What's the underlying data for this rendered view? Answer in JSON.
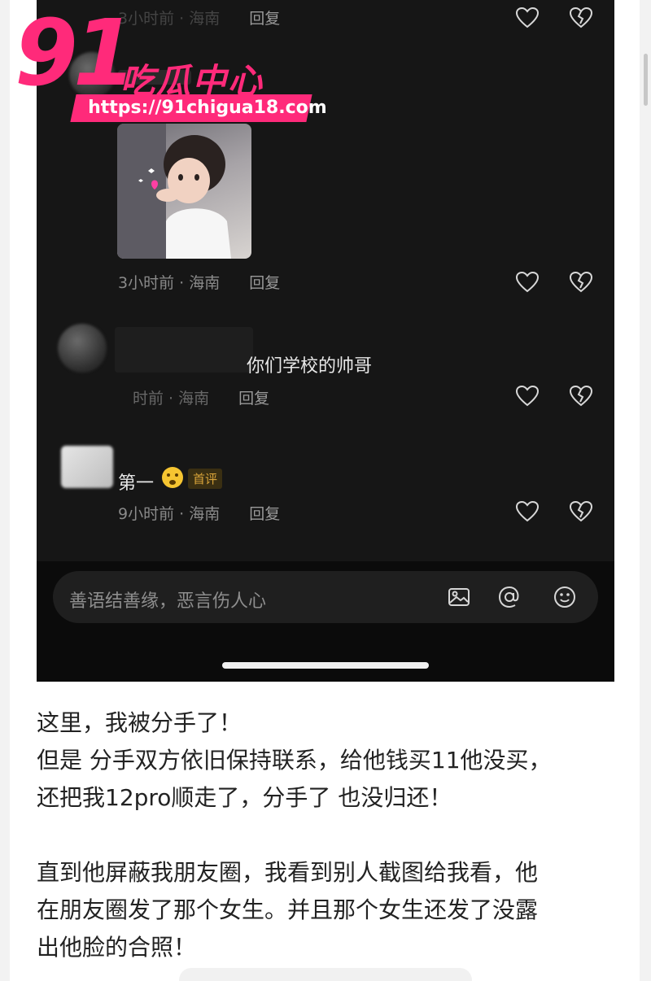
{
  "watermark": {
    "number": "91",
    "name": "吃瓜中心",
    "url": "https://91chigua18.com",
    "brand_color": "#ff2a7a"
  },
  "comments": [
    {
      "meta": "3小时前 · 海南",
      "reply_label": "回复",
      "like_icon": "heart-outline-icon",
      "dislike_icon": "broken-heart-icon"
    },
    {
      "meta": "3小时前 · 海南",
      "reply_label": "回复",
      "has_sticker": true
    },
    {
      "text": "你们学校的帅哥",
      "meta": "时前 · 海南",
      "reply_label": "回复"
    },
    {
      "text": "第一",
      "emoji": "face-emoji",
      "badge": "首评",
      "meta": "9小时前 · 海南",
      "reply_label": "回复"
    }
  ],
  "input": {
    "placeholder": "善语结善缘，恶言伤人心",
    "icons": [
      "image-icon",
      "at-icon",
      "emoji-icon"
    ]
  },
  "article": {
    "lines": [
      "这里，我被分手了！",
      "但是 分手双方依旧保持联系，给他钱买11他没买，",
      "还把我12pro顺走了，分手了 也没归还！",
      "",
      "直到他屏蔽我朋友圈，我看到别人截图给我看，他",
      "在朋友圈发了那个女生。并且那个女生还发了没露",
      "出他脸的合照！"
    ]
  },
  "colors": {
    "screen_bg": "#161616",
    "meta_text": "#8a8a8a",
    "comment_text": "#e8e8e8",
    "badge_text": "#d9a43a"
  }
}
